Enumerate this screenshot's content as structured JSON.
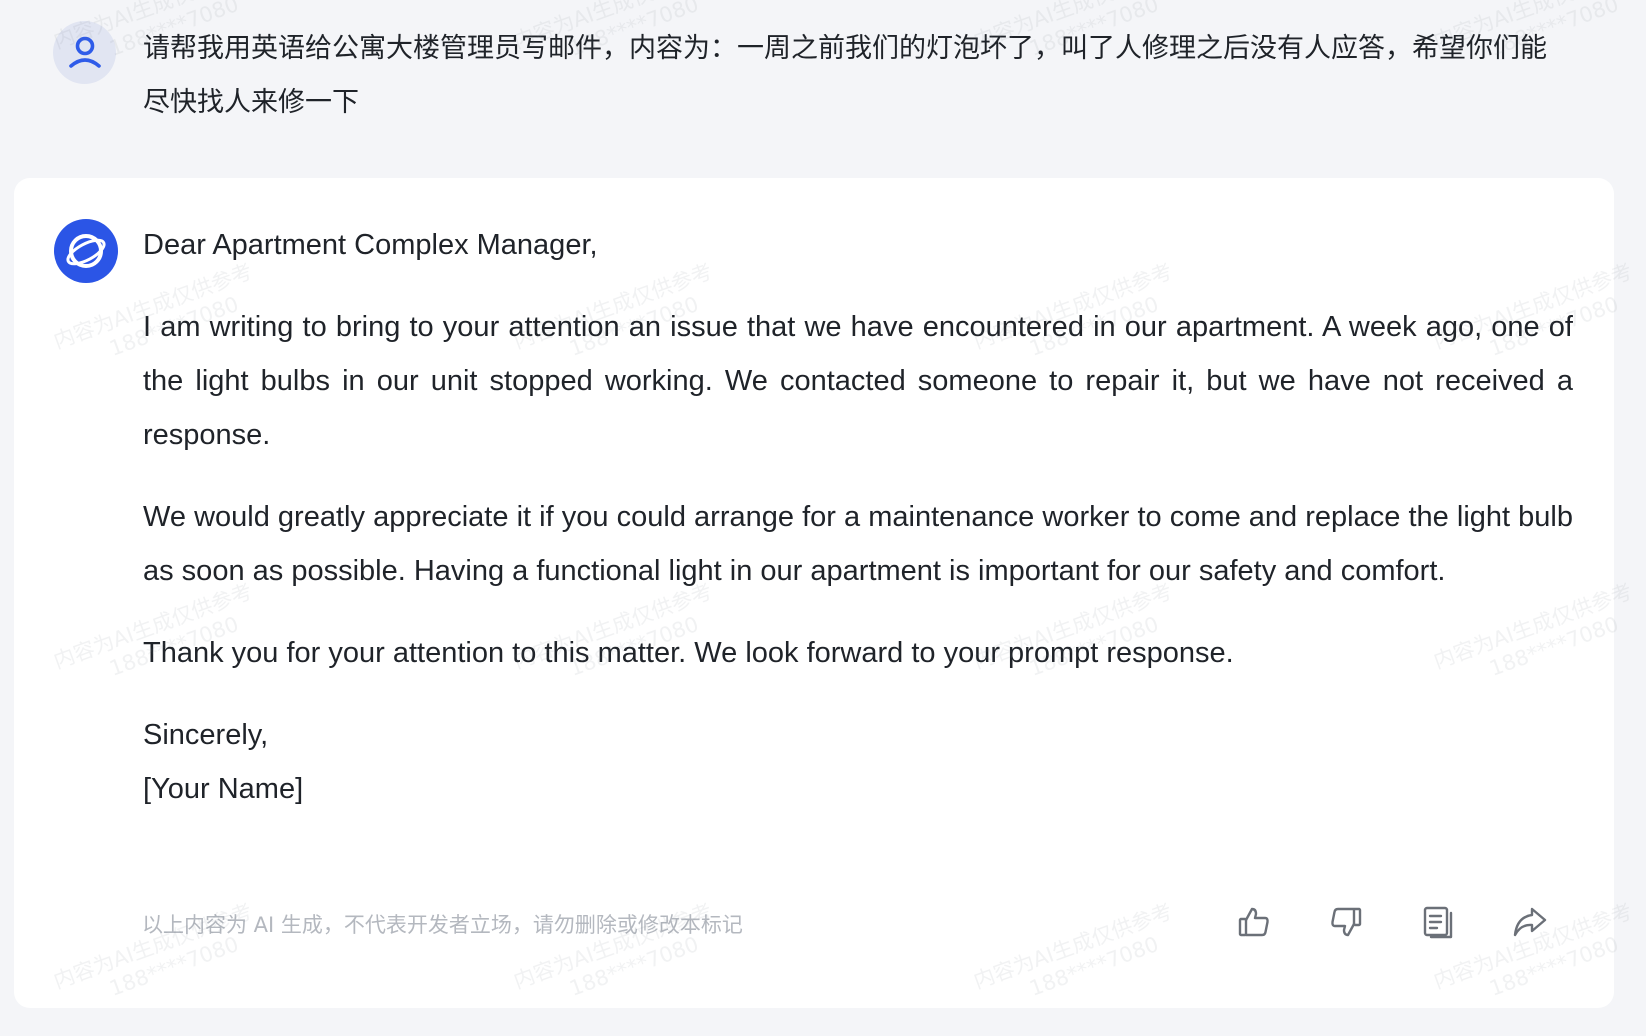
{
  "user_message": {
    "avatar_icon": "user-icon",
    "text": "请帮我用英语给公寓大楼管理员写邮件，内容为：一周之前我们的灯泡坏了，叫了人修理之后没有人应答，希望你们能尽快找人来修一下"
  },
  "ai_response": {
    "avatar_icon": "assistant-logo-icon",
    "greeting": "Dear Apartment Complex Manager,",
    "paragraphs": [
      "I am writing to bring to your attention an issue that we have encountered in our apartment. A week ago, one of the light bulbs in our unit stopped working. We contacted someone to repair it, but we have not received a response.",
      "We would greatly appreciate it if you could arrange for a maintenance worker to come and replace the light bulb as soon as possible. Having a functional light in our apartment is important for our safety and comfort.",
      "Thank you for your attention to this matter. We look forward to your prompt response."
    ],
    "closing": "Sincerely,",
    "signature": "[Your Name]",
    "disclaimer": "以上内容为 AI 生成，不代表开发者立场，请勿删除或修改本标记",
    "actions": [
      {
        "name": "like",
        "icon": "thumbs-up-icon"
      },
      {
        "name": "dislike",
        "icon": "thumbs-down-icon"
      },
      {
        "name": "copy",
        "icon": "copy-icon"
      },
      {
        "name": "share",
        "icon": "share-icon"
      }
    ]
  },
  "watermark": {
    "line1": "内容为AI生成仅供参考",
    "line2": "188****7080"
  },
  "colors": {
    "page_bg": "#f4f5f8",
    "card_bg": "#ffffff",
    "accent_blue": "#2b55e6",
    "user_icon_blue": "#2f5ce9",
    "muted_text": "#b4b8bf",
    "icon_gray": "#6b7078"
  }
}
